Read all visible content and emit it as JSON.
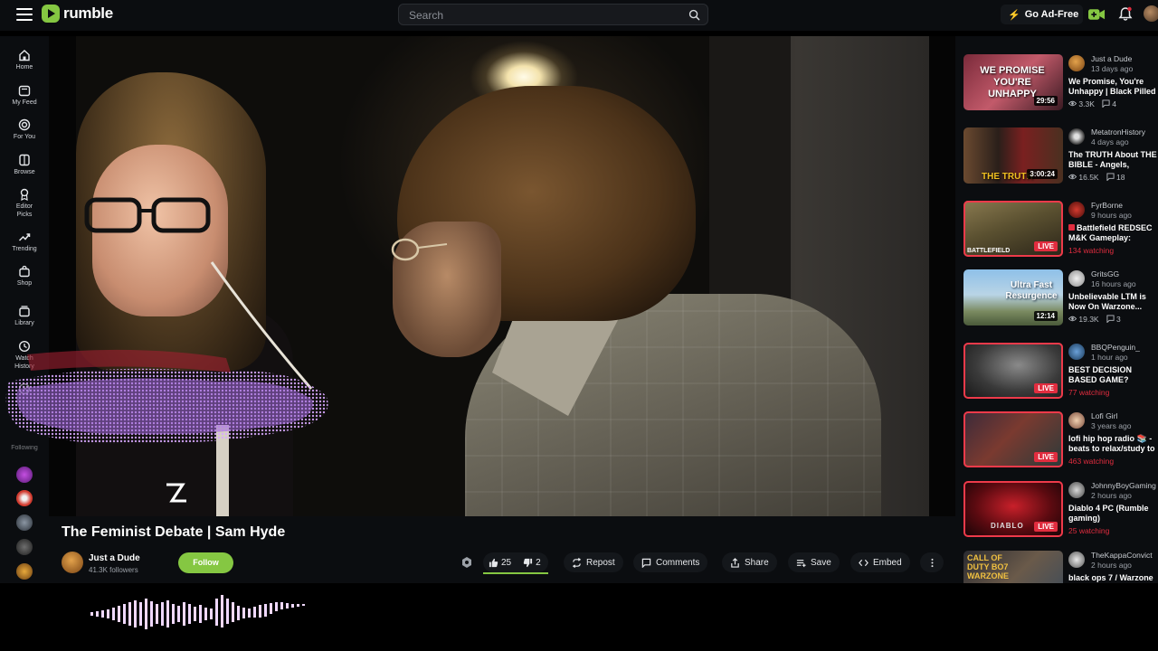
{
  "header": {
    "logo_text": "rumble",
    "search_placeholder": "Search",
    "ad_free_label": "Go Ad-Free",
    "brand_color": "#85c742"
  },
  "leftnav": {
    "items": [
      {
        "label": "Home",
        "icon": "home-icon"
      },
      {
        "label": "My Feed",
        "icon": "feed-icon"
      },
      {
        "label": "For You",
        "icon": "target-icon"
      },
      {
        "label": "Browse",
        "icon": "browse-icon"
      },
      {
        "label": "Editor Picks",
        "icon": "medal-icon"
      },
      {
        "label": "Trending",
        "icon": "trending-icon"
      },
      {
        "label": "Shop",
        "icon": "shop-icon"
      },
      {
        "label": "Library",
        "icon": "library-icon"
      },
      {
        "label": "Watch History",
        "icon": "history-icon"
      },
      {
        "label": "Watch Later",
        "icon": "clock-icon"
      },
      {
        "label": "Following",
        "icon": "following-icon"
      }
    ]
  },
  "video": {
    "title": "The Feminist Debate | Sam Hyde",
    "channel": "Just a Dude",
    "followers": "41.3K followers",
    "follow_label": "Follow",
    "likes": "25",
    "dislikes": "2",
    "actions": {
      "repost": "Repost",
      "comments": "Comments",
      "share": "Share",
      "save": "Save",
      "embed": "Embed"
    }
  },
  "recommendations": [
    {
      "channel": "Just a Dude",
      "age": "13 days ago",
      "title": "We Promise, You're Unhappy | Black Pilled",
      "views": "3.3K",
      "comments": "4",
      "duration": "29:56",
      "live": false,
      "thumb_text": "WE PROMISE YOU'RE UNHAPPY"
    },
    {
      "channel": "MetatronHistory",
      "age": "4 days ago",
      "title": "The TRUTH About THE BIBLE - Angels, Demons",
      "views": "16.5K",
      "comments": "18",
      "duration": "3:00:24",
      "live": false,
      "thumb_text": "THE TRUTH"
    },
    {
      "channel": "FyrBorne",
      "age": "9 hours ago",
      "title": "Battlefield REDSEC M&K Gameplay: Building",
      "watching": "134 watching",
      "live": true,
      "live_label": "LIVE",
      "thumb_text": "BATTLEFIELD"
    },
    {
      "channel": "GritsGG",
      "age": "16 hours ago",
      "title": "Unbelievable LTM is Now On Warzone... Buckle Up",
      "views": "19.3K",
      "comments": "3",
      "duration": "12:14",
      "live": false,
      "thumb_text": "Ultra Fast Resurgence"
    },
    {
      "channel": "BBQPenguin_",
      "age": "1 hour ago",
      "title": "BEST DECISION BASED GAME?",
      "watching": "77 watching",
      "live": true,
      "live_label": "LIVE"
    },
    {
      "channel": "Lofi Girl",
      "age": "3 years ago",
      "title": "lofi hip hop radio 📚 - beats to relax/study to",
      "watching": "463 watching",
      "live": true,
      "live_label": "LIVE"
    },
    {
      "channel": "JohnnyBoyGaming",
      "age": "2 hours ago",
      "title": "Diablo 4 PC (Rumble gaming)",
      "watching": "25 watching",
      "live": true,
      "live_label": "LIVE",
      "thumb_text": "DIABLO"
    },
    {
      "channel": "TheKappaConvict",
      "age": "2 hours ago",
      "title": "black ops 7 / Warzone",
      "live": false,
      "thumb_text": "CALL OF DUTY BO7 WARZONE"
    }
  ]
}
